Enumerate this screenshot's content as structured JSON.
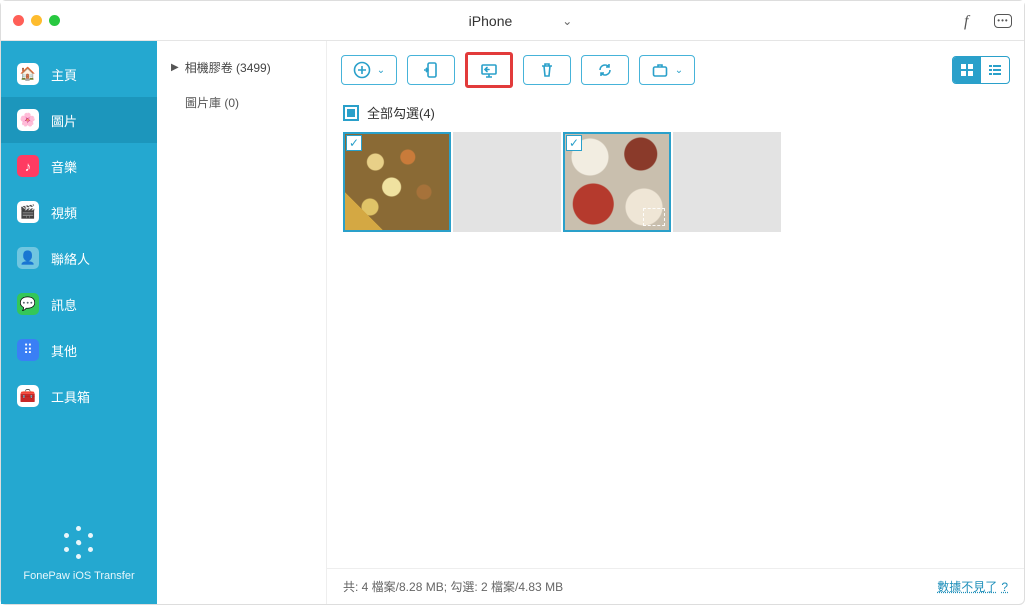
{
  "titlebar": {
    "device_name": "iPhone"
  },
  "sidebar": {
    "items": [
      {
        "label": "主頁"
      },
      {
        "label": "圖片"
      },
      {
        "label": "音樂"
      },
      {
        "label": "視頻"
      },
      {
        "label": "聯絡人"
      },
      {
        "label": "訊息"
      },
      {
        "label": "其他"
      },
      {
        "label": "工具箱"
      }
    ],
    "brand": "FonePaw iOS Transfer"
  },
  "seccol": {
    "camera_roll": "相機膠卷 (3499)",
    "photo_library": "圖片庫 (0)"
  },
  "content": {
    "select_all": "全部勾選(4)"
  },
  "statusbar": {
    "text": "共: 4 檔案/8.28 MB; 勾選: 2 檔案/4.83 MB",
    "help": "數據不見了",
    "help_q": "?"
  }
}
